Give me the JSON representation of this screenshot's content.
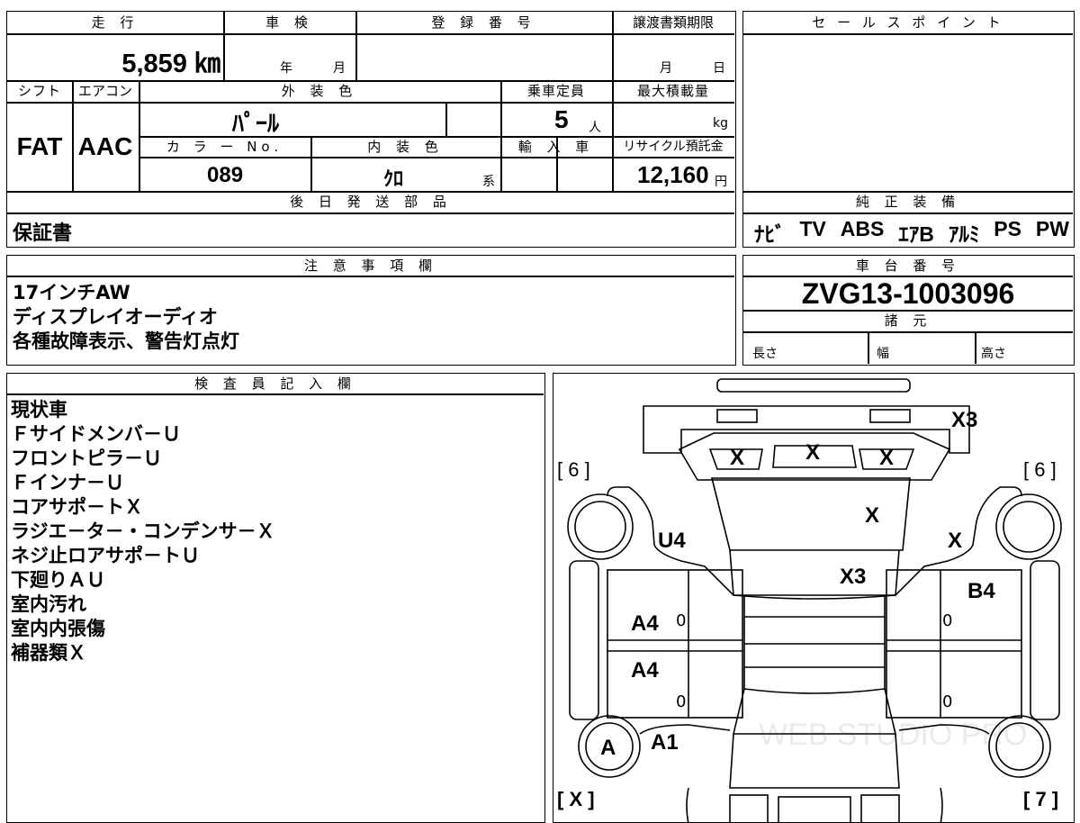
{
  "vehicle": {
    "labels": {
      "mileage": "走 行",
      "inspection": "車 検",
      "registration": "登 録 番 号",
      "transfer_deadline": "譲渡書類期限",
      "shift": "シフト",
      "aircon": "エアコン",
      "exterior_color": "外 装 色",
      "capacity": "乗車定員",
      "max_load": "最大積載量",
      "color_no": "カ ラ ー No.",
      "interior_color": "内 装 色",
      "import": "輸 入 車",
      "recycle_fee": "リサイクル預託金",
      "sales_point": "セ ー ル ス ポ イ ン ト",
      "later_parts": "後 日 発 送 部 品",
      "genuine_equipment": "純 正 装 備",
      "notes": "注 意 事 項 欄",
      "chassis_number": "車 台 番 号",
      "specs": "諸 元",
      "length": "長さ",
      "width": "幅",
      "height": "高さ",
      "inspector": "検 査 員 記 入 欄"
    },
    "mileage": "5,859 ㎞",
    "inspection_year_unit": "年",
    "inspection_month_unit": "月",
    "deadline_month_unit": "月",
    "deadline_day_unit": "日",
    "shift": "FAT",
    "aircon": "AAC",
    "exterior_color": "ﾊﾟｰﾙ",
    "capacity": "5",
    "capacity_unit": "人",
    "max_load_unit": "kg",
    "color_no": "089",
    "interior_color": "ｸﾛ",
    "interior_suffix": "系",
    "recycle_fee": "12,160",
    "recycle_unit": "円",
    "later_parts": "保証書",
    "genuine_equipment": [
      "ﾅﾋﾞ",
      "TV",
      "ABS",
      "ｴｱB",
      "ｱﾙﾐ",
      "PS",
      "PW"
    ],
    "notes": [
      "17インチAW",
      "ディスプレイオーディオ",
      "各種故障表示、警告灯点灯"
    ],
    "chassis_number": "ZVG13-1003096",
    "inspector_notes": [
      "現状車",
      "Ｆサイドメンバ－Ｕ",
      "フロントピラ－Ｕ",
      "Ｆインナ－Ｕ",
      "コアサポ－トＸ",
      "ラジエ－タ－・コンデンサ－Ｘ",
      "ネジ止ロアサポ－トＵ",
      "下廻りＡＵ",
      "室内汚れ",
      "室内内張傷",
      "補器類Ｘ"
    ]
  },
  "diagram": {
    "bracket_front_left": "[ 6 ]",
    "bracket_front_right": "[ 6 ]",
    "bracket_rear_left": "[ X ]",
    "bracket_rear_right": "[ 7 ]",
    "marks": {
      "bumper": "X3",
      "glass_left": "X",
      "glass_center": "X",
      "glass_right": "X",
      "hood": "X",
      "fender_left": "U4",
      "fender_right": "X",
      "cowl": "X3",
      "front_door_left": "A4",
      "rear_door_left": "A4",
      "front_door_right": "B4",
      "door_zero_1": "0",
      "door_zero_2": "0",
      "door_zero_3": "0",
      "door_zero_4": "0",
      "tire_rear_left": "A",
      "quarter_left": "A1"
    },
    "watermark": "WEB STUDIO PRO"
  }
}
